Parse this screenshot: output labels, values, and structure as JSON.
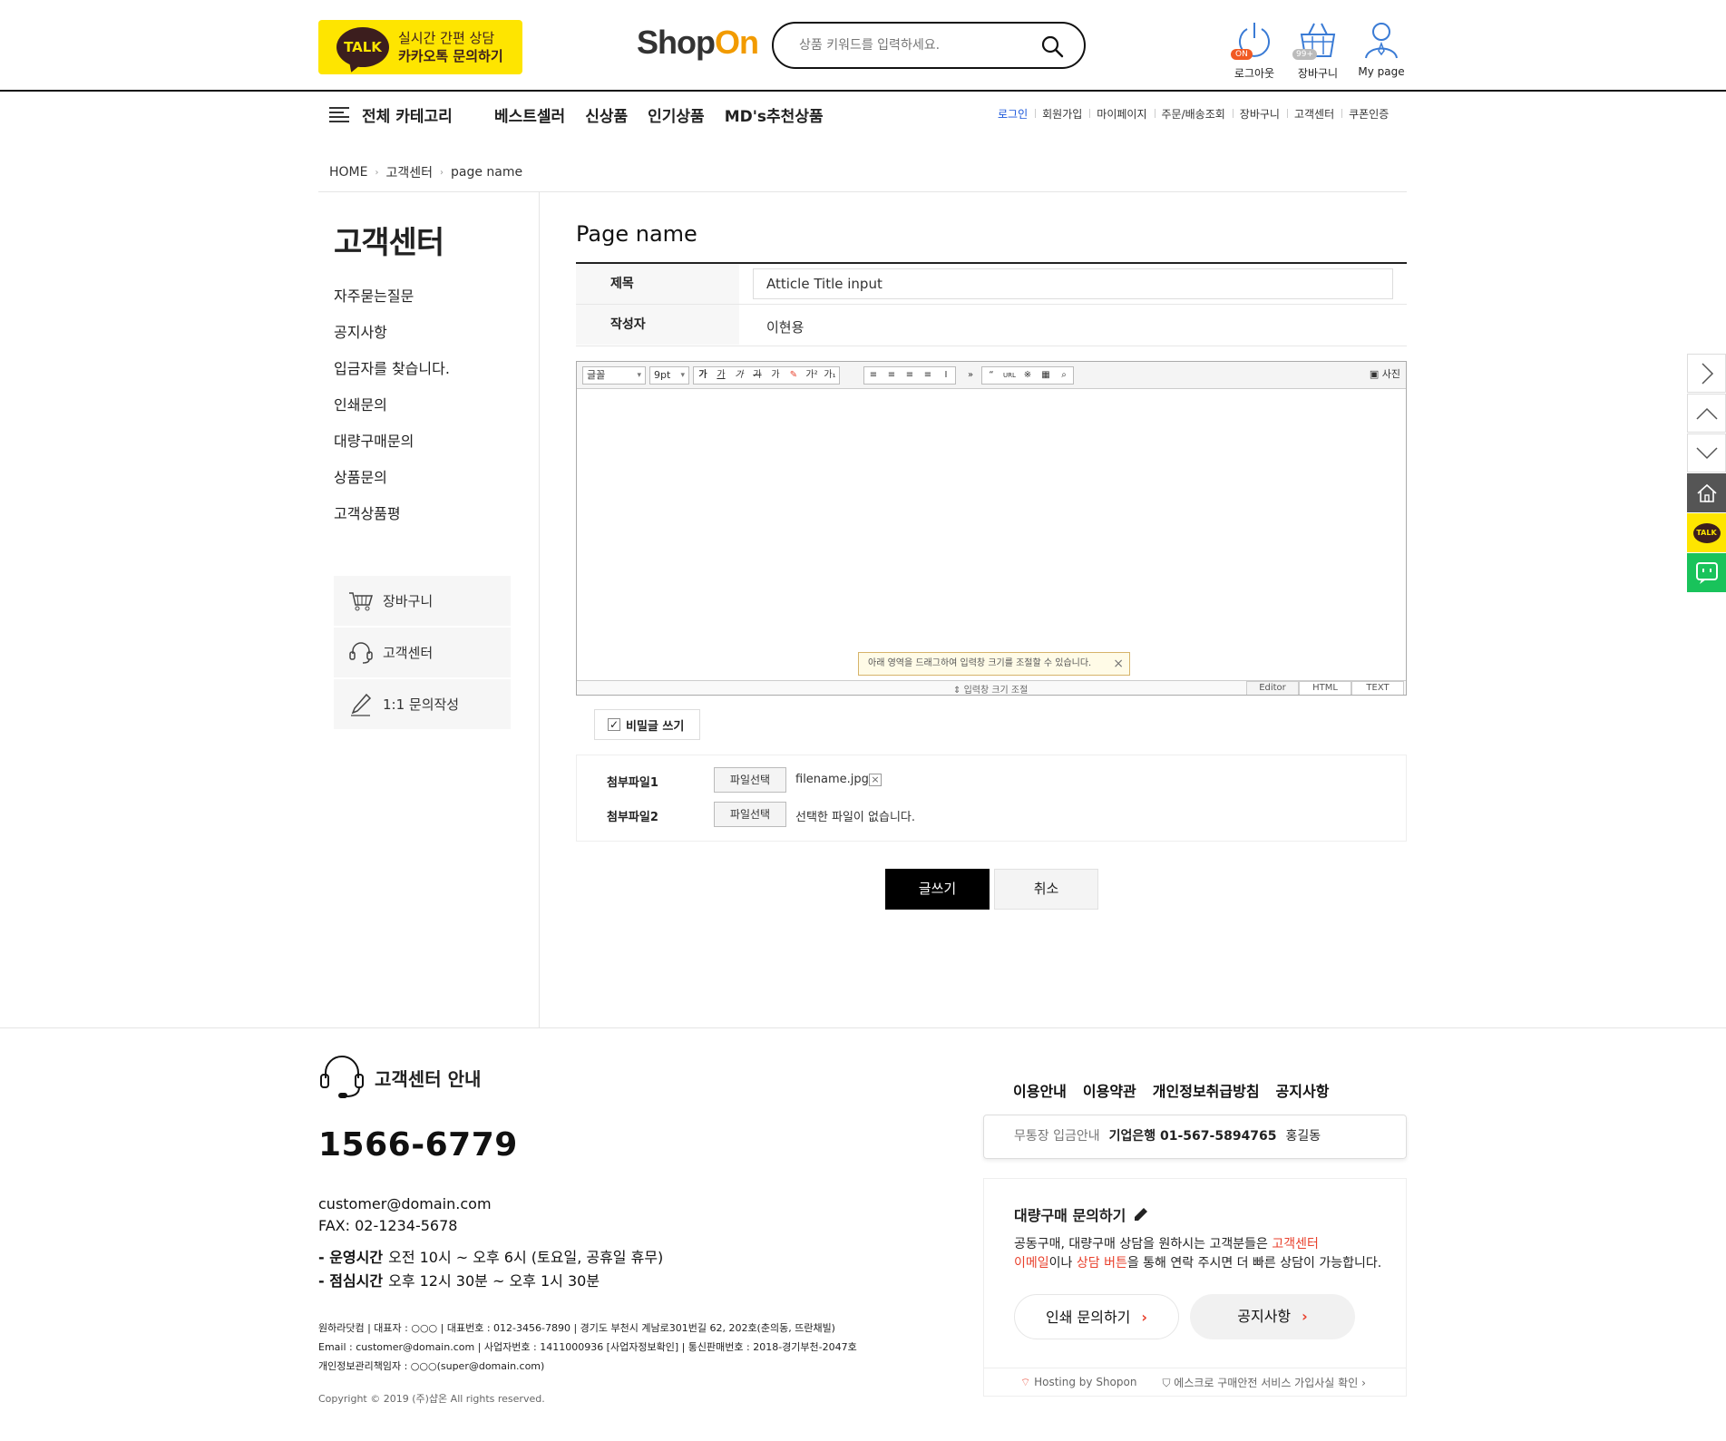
{
  "header": {
    "talk_t1": "실시간 간편 상담",
    "talk_t2": "카카오톡 문의하기",
    "talk_badge": "TALK",
    "logo_shop": "Shop",
    "logo_on": "On",
    "search_placeholder": "상품 키워드를 입력하세요.",
    "icons": [
      {
        "name": "power-icon",
        "label": "로그아웃",
        "badge": "ON"
      },
      {
        "name": "basket-icon",
        "label": "장바구니",
        "badge": "99+"
      },
      {
        "name": "user-icon",
        "label": "My page"
      }
    ]
  },
  "nav": {
    "category": "전체 카테고리",
    "gnb": [
      "베스트셀러",
      "신상품",
      "인기상품",
      "MD's추천상품"
    ],
    "util": [
      "로그인",
      "회원가입",
      "마이페이지",
      "주문/배송조회",
      "장바구니",
      "고객센터",
      "쿠폰인증"
    ],
    "util_active": "로그인"
  },
  "breadcrumb": [
    "HOME",
    "고객센터",
    "page name"
  ],
  "sidebar": {
    "title": "고객센터",
    "menu": [
      "자주묻는질문",
      "공지사항",
      "입금자를 찾습니다.",
      "인쇄문의",
      "대량구매문의",
      "상품문의",
      "고객상품평"
    ],
    "boxes": [
      {
        "icon": "cart-icon",
        "label": "장바구니"
      },
      {
        "icon": "headset-icon",
        "label": "고객센터"
      },
      {
        "icon": "pencil-icon",
        "label": "1:1 문의작성"
      }
    ]
  },
  "form": {
    "page_title": "Page name",
    "title_label": "제목",
    "title_value": "Atticle Title input",
    "author_label": "작성자",
    "author_value": "이현용",
    "editor": {
      "font_select": "글꼴",
      "size_select": "9pt",
      "photo_label": "사진",
      "tip": "아래 영역을 드래그하여 입력창 크기를 조절할 수 있습니다.",
      "resize_label": "입력창 크기 조절",
      "modes": [
        "Editor",
        "HTML",
        "TEXT"
      ]
    },
    "secret_label": "비밀글 쓰기",
    "attach1_label": "첨부파일1",
    "attach2_label": "첨부파일2",
    "file_button": "파일선택",
    "file1_name": "filename.jpg",
    "file2_name": "선택한 파일이 없습니다.",
    "submit": "글쓰기",
    "cancel": "취소"
  },
  "footer": {
    "cs_title": "고객센터 안내",
    "phone": "1566-6779",
    "email": "customer@domain.com",
    "fax": "FAX: 02-1234-5678",
    "hours1_label": "- 운영시간",
    "hours1_value": "오전 10시 ~ 오후 6시 (토요일, 공휴일 휴무)",
    "hours2_label": "- 점심시간",
    "hours2_value": "오후 12시 30분 ~ 오후 1시 30분",
    "biz1": "원하라닷컴 | 대표자 : ○○○ | 대표번호 : 012-3456-7890 | 경기도 부천시 계남로301번길 62, 202호(춘의동, 뜨란채빌)",
    "biz2": "Email : customer@domain.com | 사업자번호 : 1411000936 [사업자정보확인] | 통신판매번호 : 2018-경기부천-2047호",
    "biz3": "개인정보관리책임자 : ○○○(super@domain.com)",
    "copyright": "Copyright © 2019 (주)샵온 All rights reserved.",
    "links": [
      "이용안내",
      "이용약관",
      "개인정보취급방침",
      "공지사항"
    ],
    "bank_label": "무통장 입금안내",
    "bank_account": "기업은행 01-567-5894765",
    "bank_holder": "홍길동",
    "bulk_title": "대량구매 문의하기",
    "bulk_text_1": "공동구매, 대량구매 상담을 원하시는 고객분들은 ",
    "bulk_red_1": "고객센터",
    "bulk_red_2": "이메일",
    "bulk_text_2": "이나 ",
    "bulk_red_3": "상담 버튼",
    "bulk_text_3": "을 통해 연락 주시면 더 빠른 상담이 가능합니다.",
    "pill1": "인쇄 문의하기",
    "pill2": "공지사항",
    "hosting": "Hosting by Shopon",
    "escrow": "에스크로 구매안전 서비스 가입사실 확인"
  },
  "colors": {
    "kakao_yellow": "#fee500",
    "accent_orange": "#f29b00",
    "link_blue": "#1a56db",
    "alert_red": "#e8402c",
    "icon_blue": "#3a7bd5"
  }
}
